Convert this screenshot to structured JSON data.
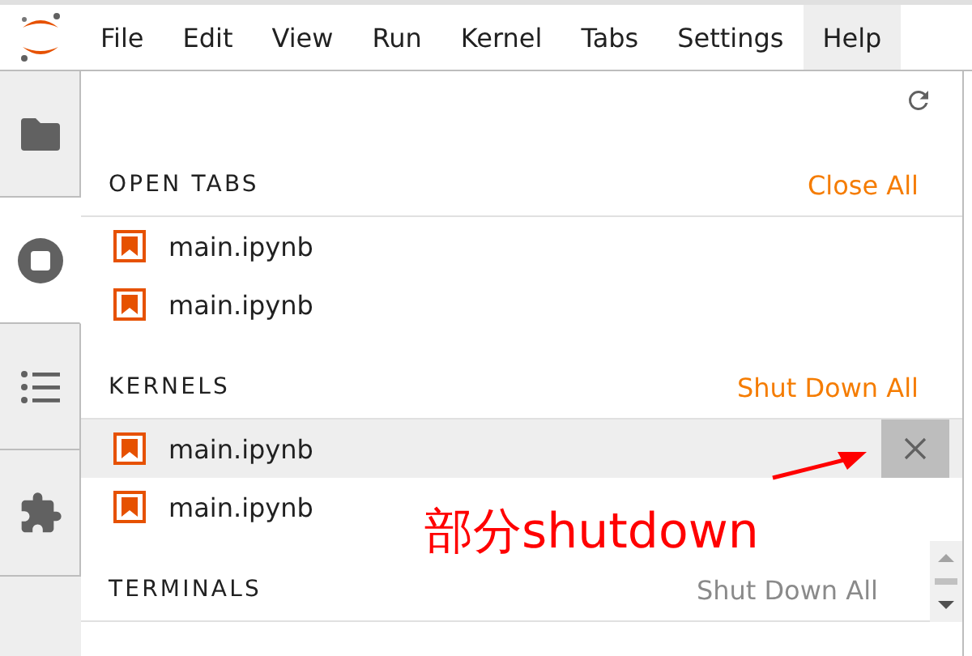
{
  "menu": {
    "items": [
      {
        "label": "File",
        "selected": false
      },
      {
        "label": "Edit",
        "selected": false
      },
      {
        "label": "View",
        "selected": false
      },
      {
        "label": "Run",
        "selected": false
      },
      {
        "label": "Kernel",
        "selected": false
      },
      {
        "label": "Tabs",
        "selected": false
      },
      {
        "label": "Settings",
        "selected": false
      },
      {
        "label": "Help",
        "selected": true
      }
    ]
  },
  "sidebar": {
    "tabs": [
      {
        "kind": "folder",
        "selected": false
      },
      {
        "kind": "running",
        "selected": true
      },
      {
        "kind": "toc",
        "selected": false
      },
      {
        "kind": "extension",
        "selected": false
      }
    ]
  },
  "sections": [
    {
      "title": "OPEN TABS",
      "action": "Close All",
      "disabled": false,
      "items": [
        {
          "name": "main.ipynb",
          "hovered": false
        },
        {
          "name": "main.ipynb",
          "hovered": false
        }
      ]
    },
    {
      "title": "KERNELS",
      "action": "Shut Down All",
      "disabled": false,
      "items": [
        {
          "name": "main.ipynb",
          "hovered": true
        },
        {
          "name": "main.ipynb",
          "hovered": false
        }
      ]
    },
    {
      "title": "TERMINALS",
      "action": "Shut Down All",
      "disabled": true
    }
  ],
  "annotation": {
    "text": "部分shutdown"
  }
}
